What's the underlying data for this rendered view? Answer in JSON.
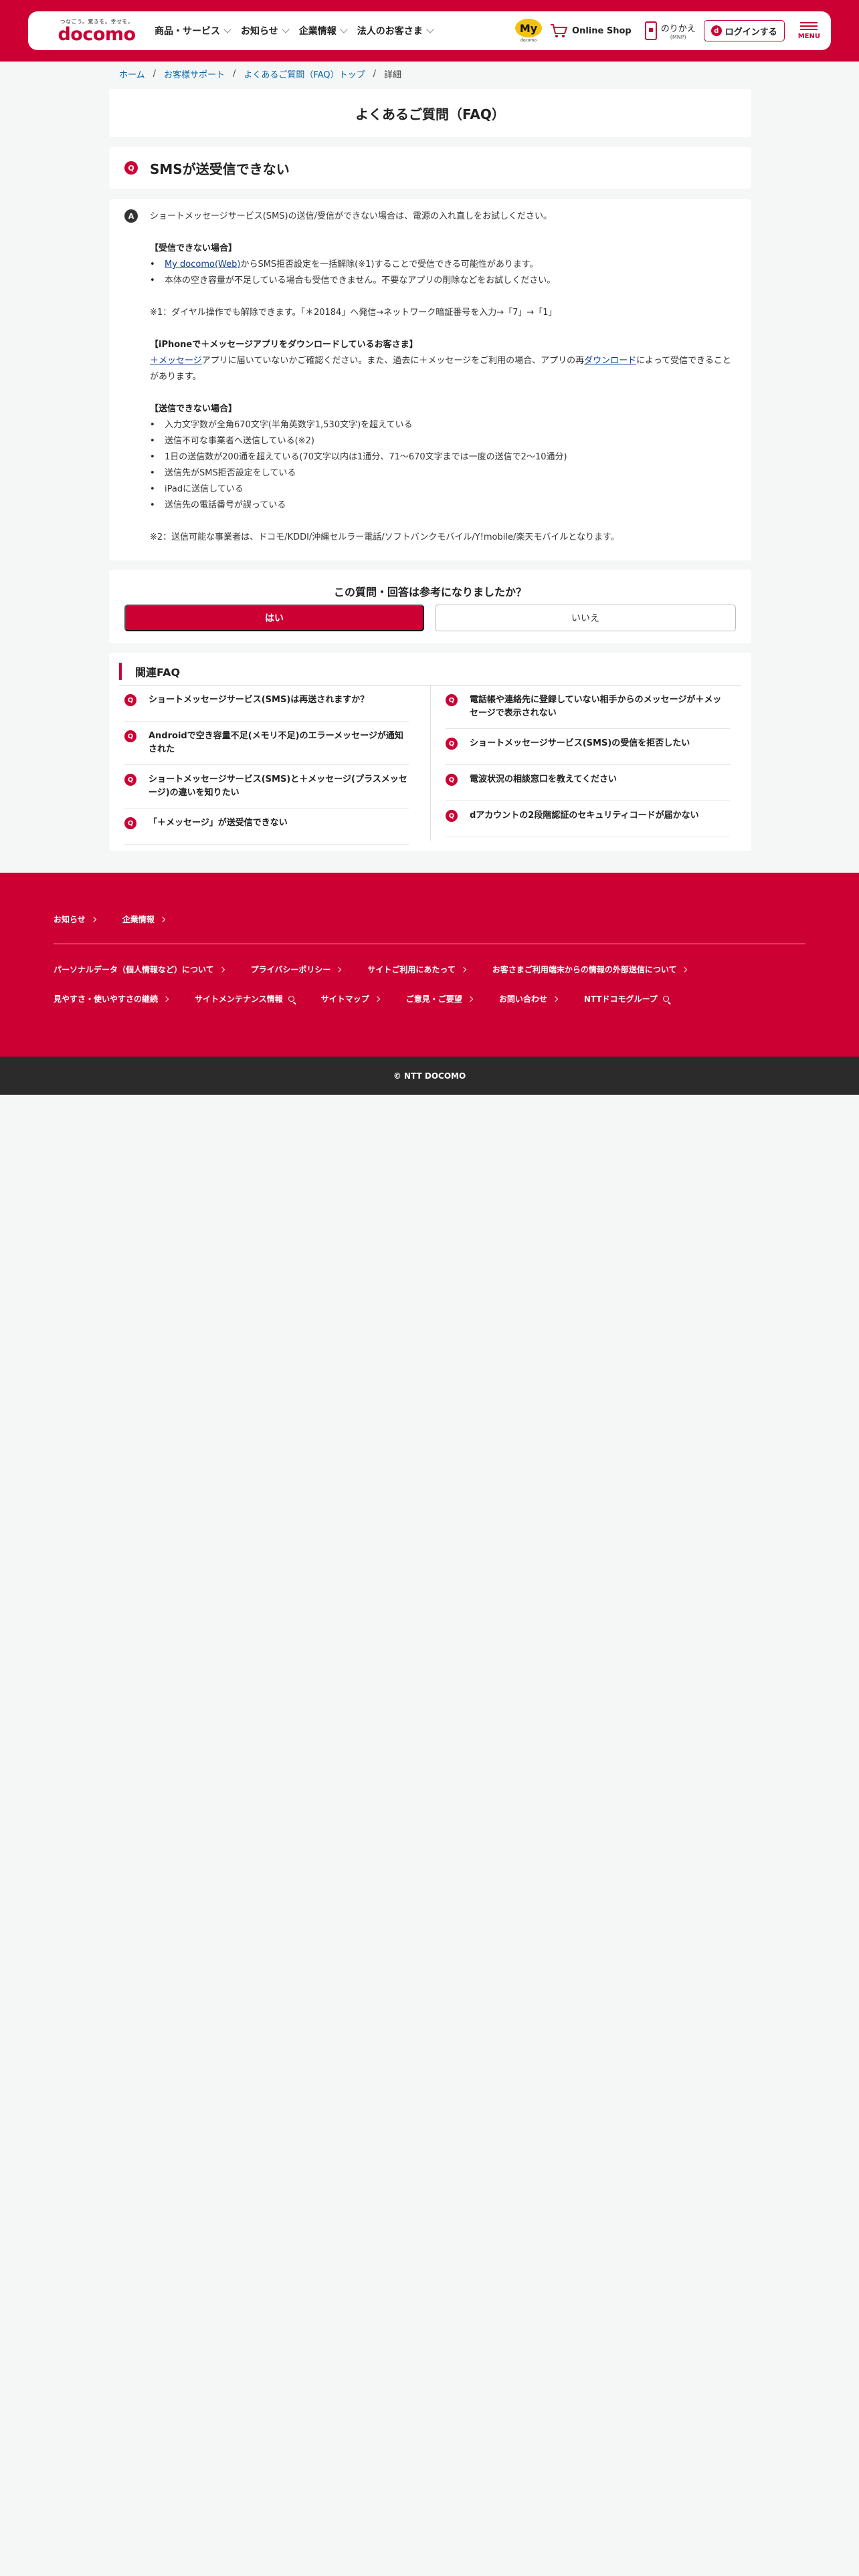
{
  "header": {
    "logo_tagline": "つなごう。驚きを。幸せを。",
    "logo_text": "docomo",
    "nav": [
      "商品・サービス",
      "お知らせ",
      "企業情報",
      "法人のお客さま"
    ],
    "my_docomo_label": "My",
    "my_docomo_sub": "docomo",
    "online_shop": "Online Shop",
    "norikae": "のりかえ",
    "norikae_sub": "(MNP)",
    "login": "ログインする",
    "login_icon": "d",
    "menu": "MENU"
  },
  "breadcrumb": {
    "items": [
      "ホーム",
      "お客様サポート",
      "よくあるご質問（FAQ）トップ"
    ],
    "current": "詳細"
  },
  "page_title": "よくあるご質問（FAQ）",
  "question": {
    "icon": "Q",
    "title": "SMSが送受信できない"
  },
  "answer": {
    "icon": "A",
    "intro": "ショートメッセージサービス(SMS)の送信/受信ができない場合は、電源の入れ直しをお試しください。",
    "receive_heading": "【受信できない場合】",
    "receive_b1_link": "My docomo(Web)",
    "receive_b1_rest": "からSMS拒否設定を一括解除(※1)することで受信できる可能性があります。",
    "receive_b2": "本体の空き容量が不足している場合も受信できません。不要なアプリの削除などをお試しください。",
    "note1": "※1：ダイヤル操作でも解除できます。「＊20184」へ発信→ネットワーク暗証番号を入力→「7」→「1」",
    "iphone_heading": "【iPhoneで＋メッセージアプリをダウンロードしているお客さま】",
    "iphone_link1": "＋メッセージ",
    "iphone_text1": "アプリに届いていないかご確認ください。また、過去に＋メッセージをご利用の場合、アプリの再",
    "iphone_link2": "ダウンロード",
    "iphone_text2": "によって受信できることがあります。",
    "send_heading": "【送信できない場合】",
    "send_bullets": [
      "入力文字数が全角670文字(半角英数字1,530文字)を超えている",
      "送信不可な事業者へ送信している(※2)",
      "1日の送信数が200通を超えている(70文字以内は1通分、71〜670文字までは一度の送信で2〜10通分)",
      "送信先がSMS拒否設定をしている",
      "iPadに送信している",
      "送信先の電話番号が誤っている"
    ],
    "note2": "※2：送信可能な事業者は、ドコモ/KDDI/沖縄セルラー電話/ソフトバンクモバイル/Y!mobile/楽天モバイルとなります。"
  },
  "survey": {
    "question": "この質問・回答は参考になりましたか？",
    "yes": "はい",
    "no": "いいえ"
  },
  "related": {
    "heading": "関連FAQ",
    "icon": "Q",
    "left": [
      "ショートメッセージサービス(SMS)は再送されますか？",
      "Androidで空き容量不足(メモリ不足)のエラーメッセージが通知された",
      "ショートメッセージサービス(SMS)と＋メッセージ(プラスメッセージ)の違いを知りたい",
      "「＋メッセージ」が送受信できない"
    ],
    "right": [
      "電話帳や連絡先に登録していない相手からのメッセージが＋メッセージで表示されない",
      "ショートメッセージサービス(SMS)の受信を拒否したい",
      "電波状況の相談窓口を教えてください",
      "dアカウントの2段階認証のセキュリティコードが届かない"
    ]
  },
  "footer": {
    "row1": [
      "お知らせ",
      "企業情報"
    ],
    "row2": [
      "パーソナルデータ（個人情報など）について",
      "プライバシーポリシー",
      "サイトご利用にあたって",
      "お客さまご利用端末からの情報の外部送信について"
    ],
    "row3": [
      "見やすさ・使いやすさの継続",
      "サイトメンテナンス情報",
      "サイトマップ",
      "ご意見・ご要望",
      "お問い合わせ",
      "NTTドコモグループ"
    ],
    "copyright": "© NTT DOCOMO"
  },
  "colors": {
    "brand": "#cc0033",
    "link": "#0066aa",
    "dark_bar": "#2b2b2b"
  }
}
